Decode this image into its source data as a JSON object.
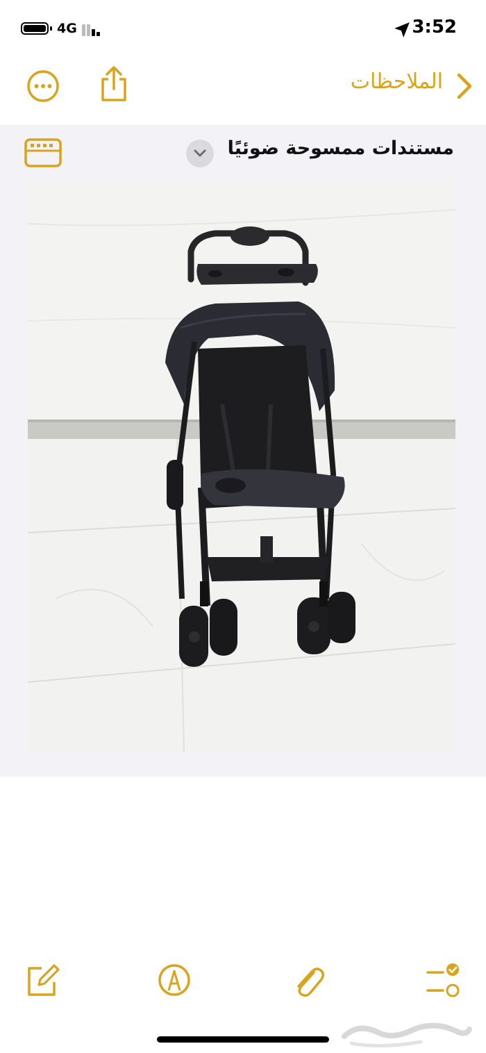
{
  "status": {
    "network": "4G",
    "time": "3:52",
    "battery_level": 1.0,
    "signal_bars_active": 2
  },
  "nav": {
    "back_label": "الملاحظات",
    "back_icon": "chevron-right-icon",
    "share_icon": "share-icon",
    "more_icon": "ellipsis-circle-icon"
  },
  "note": {
    "title": "مستندات ممسوحة ضوئيًا",
    "title_chevron_icon": "chevron-down-icon",
    "scan_icon": "scanned-document-icon",
    "image": "scanned-photo-of-black-baby-stroller"
  },
  "toolbar": {
    "checklist_icon": "checklist-icon",
    "attach_icon": "paperclip-icon",
    "markup_icon": "markup-pen-icon",
    "compose_icon": "compose-icon"
  },
  "watermark": {
    "text": "حراج"
  },
  "colors": {
    "accent": "#D9A41C",
    "background": "#FFFFFF",
    "content_background": "#F2F2F7"
  }
}
